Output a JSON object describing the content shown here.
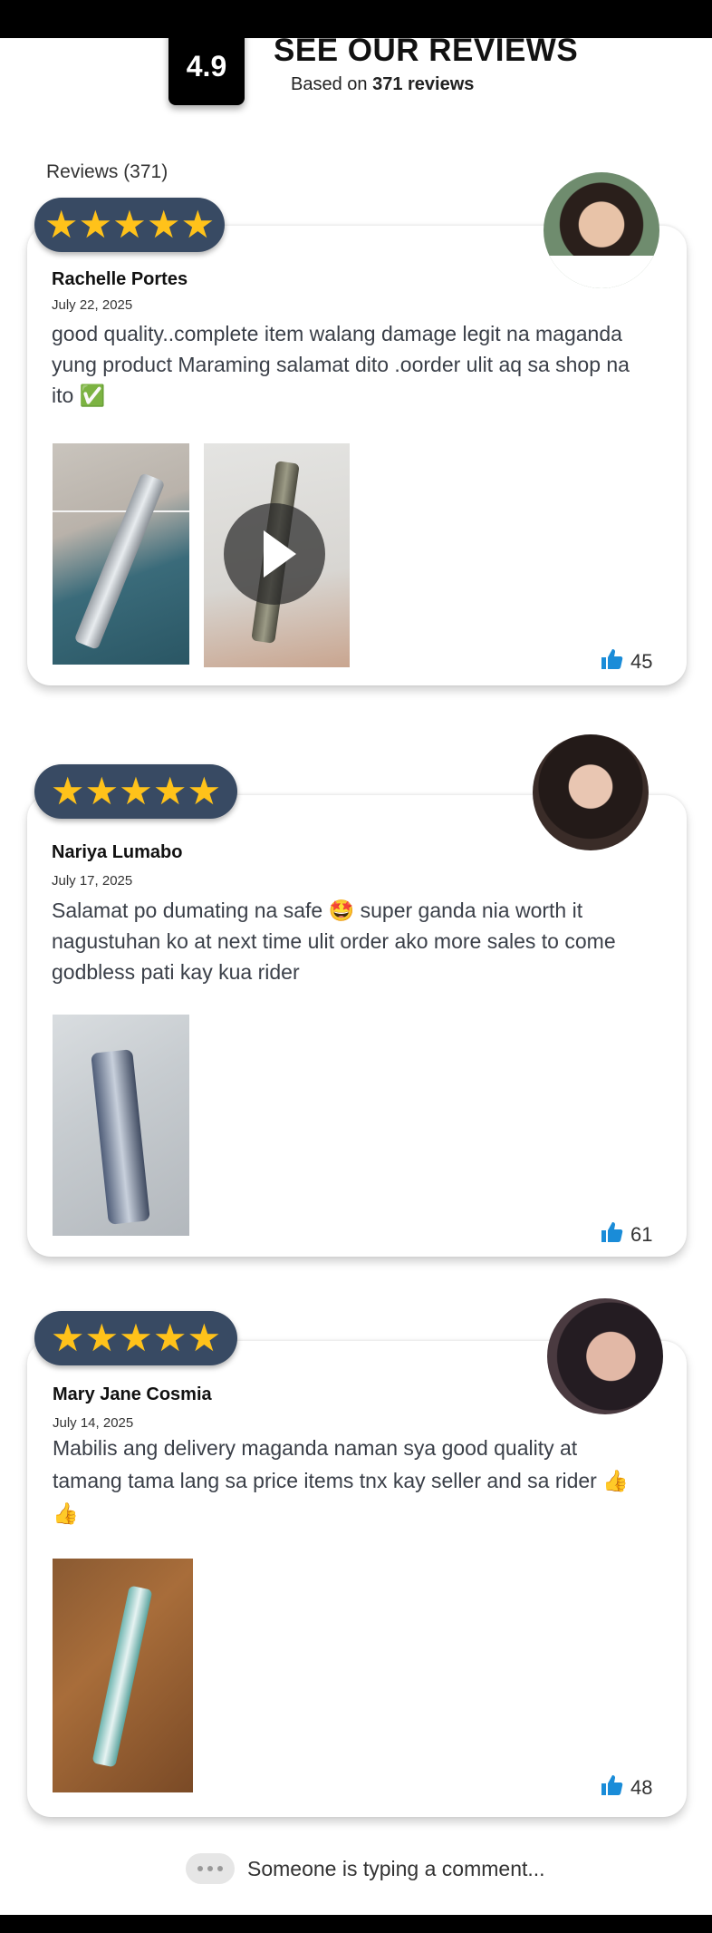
{
  "header": {
    "score": "4.9",
    "title": "SEE OUR REVIEWS",
    "subtitle_prefix": "Based on",
    "subtitle_count": "371 reviews"
  },
  "reviews_count_label": "Reviews (371)",
  "stars": "★★★★★",
  "reviews": [
    {
      "name": "Rachelle Portes",
      "date": "July 22, 2025",
      "text": "good quality..complete item walang damage legit na maganda yung product  Maraming salamat dito  .oorder ulit aq  sa shop na ito ✅",
      "likes": "45"
    },
    {
      "name": "Nariya Lumabo",
      "date": "July 17, 2025",
      "text": "Salamat po dumating na safe 🤩 super ganda nia worth it nagustuhan ko  at  next time ulit order ako more sales to come godbless pati kay kua rider",
      "likes": "61"
    },
    {
      "name": "Mary Jane Cosmia",
      "date": "July 14, 2025",
      "text": "Mabilis ang delivery maganda naman  sya  good quality at  tamang tama lang sa price items tnx kay seller and sa rider 👍👍",
      "likes": "48"
    }
  ],
  "typing_text": "Someone is typing a comment...",
  "colors": {
    "pill": "#384a63",
    "star": "#ffc21a",
    "like": "#1a8cd8"
  }
}
